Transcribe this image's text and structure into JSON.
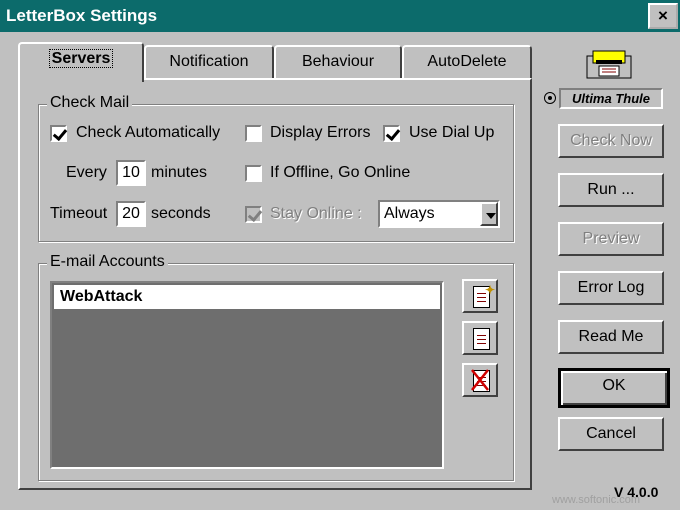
{
  "window": {
    "title": "LetterBox Settings",
    "close_glyph": "×"
  },
  "tabs": [
    {
      "label": "Servers",
      "active": true
    },
    {
      "label": "Notification",
      "active": false
    },
    {
      "label": "Behaviour",
      "active": false
    },
    {
      "label": "AutoDelete",
      "active": false
    }
  ],
  "check_mail": {
    "group_label": "Check Mail",
    "check_auto": {
      "label": "Check Automatically",
      "checked": true
    },
    "display_errors": {
      "label": "Display Errors",
      "checked": false
    },
    "use_dial_up": {
      "label": "Use Dial Up",
      "checked": true
    },
    "every_label": "Every",
    "every_value": "10",
    "minutes_label": "minutes",
    "if_offline": {
      "label": "If Offline, Go Online",
      "checked": false
    },
    "timeout_label": "Timeout",
    "timeout_value": "20",
    "seconds_label": "seconds",
    "stay_online": {
      "label": "Stay Online :",
      "checked": true,
      "disabled": true
    },
    "stay_online_select": "Always"
  },
  "accounts": {
    "group_label": "E-mail Accounts",
    "items": [
      "WebAttack"
    ],
    "icons": [
      "new-account-icon",
      "edit-account-icon",
      "delete-account-icon"
    ]
  },
  "brand": {
    "name": "Ultima Thule"
  },
  "buttons": {
    "check_now": "Check Now",
    "run": "Run ...",
    "preview": "Preview",
    "error_log": "Error Log",
    "read_me": "Read Me",
    "ok": "OK",
    "cancel": "Cancel"
  },
  "version": "V 4.0.0",
  "watermark": "www.softonic.com",
  "colors": {
    "titlebar": "#0c6b6b",
    "face": "#c0c0c0",
    "list_bg": "#6e6e6e"
  }
}
